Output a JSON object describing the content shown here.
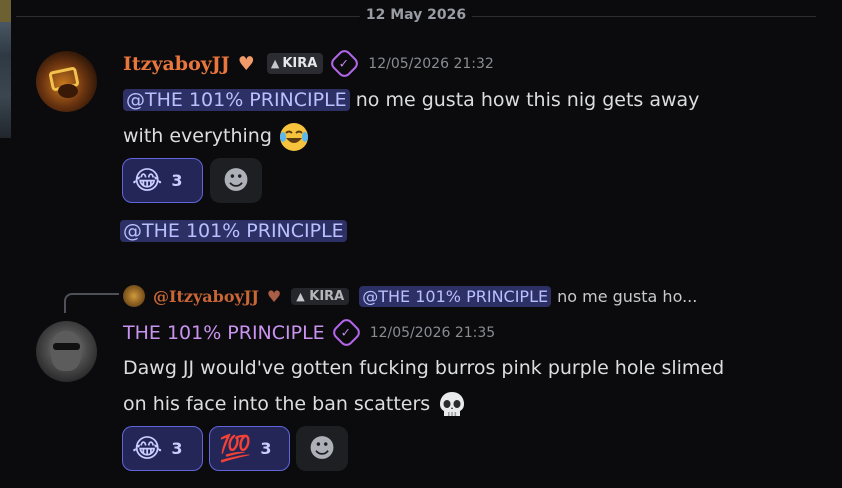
{
  "date_divider": "12 May 2026",
  "messages": [
    {
      "username": "ItzyaboyJJ",
      "heart": "♥",
      "tag": "KIRA",
      "tag_icon": "▲",
      "verify_icon": "✓",
      "timestamp": "12/05/2026 21:32",
      "mention": "@THE 101% PRINCIPLE",
      "text_line1": "no me gusta how this nig gets away",
      "text_line2": "with everything",
      "reactions": [
        {
          "emoji": "😂",
          "count": "3",
          "icon": "laughing-face"
        },
        {
          "emoji": "☻",
          "icon": "add-reaction"
        }
      ],
      "followup_mention": "@THE 101% PRINCIPLE"
    },
    {
      "reply_to": {
        "username": "@ItzyaboyJJ",
        "heart": "♥",
        "tag": "KIRA",
        "mention": "@THE 101% PRINCIPLE",
        "text": "no me gusta ho..."
      },
      "username": "THE 101% PRINCIPLE",
      "verify_icon": "✓",
      "timestamp": "12/05/2026 21:35",
      "text_line1": "Dawg JJ would've gotten fucking burros pink purple hole slimed",
      "text_line2": "on his face into the ban scatters",
      "reactions": [
        {
          "emoji": "😂",
          "count": "3",
          "icon": "laughing-face"
        },
        {
          "emoji": "💯",
          "count": "3",
          "icon": "hundred-points"
        },
        {
          "emoji": "☻",
          "icon": "add-reaction"
        }
      ]
    }
  ],
  "colors": {
    "accent": "#6066d9",
    "mention_bg": "#2d3064",
    "username1": "#e9773d",
    "username2": "#c993f0"
  }
}
